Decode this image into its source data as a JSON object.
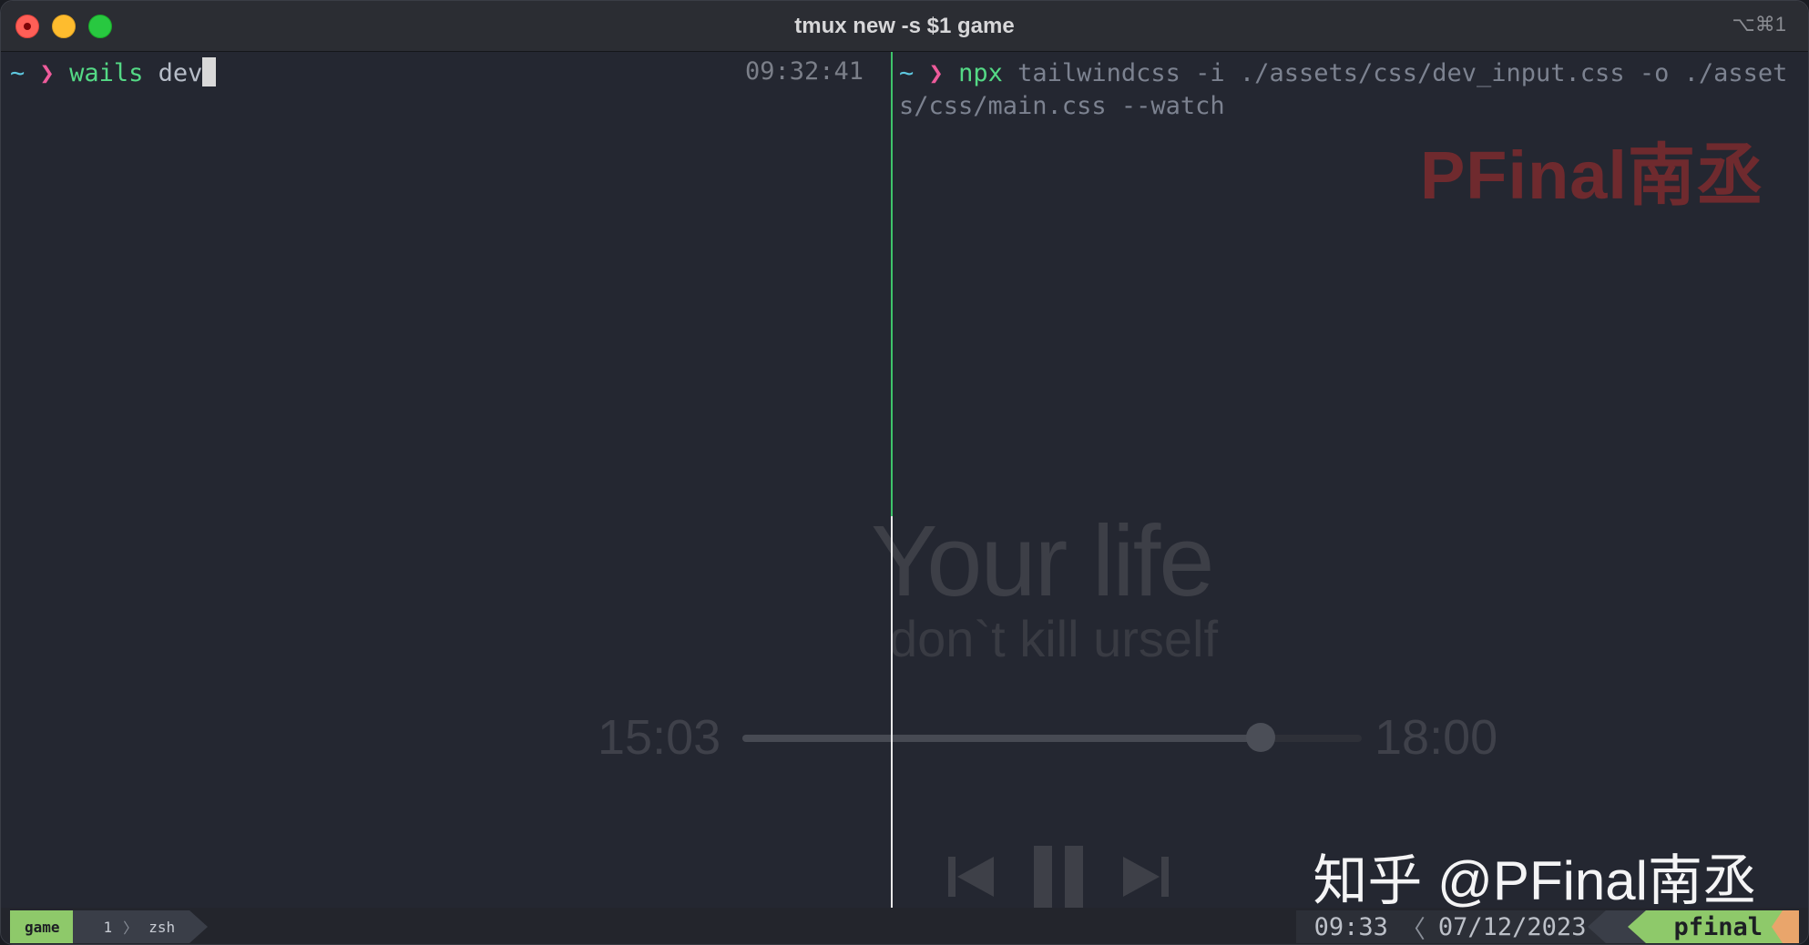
{
  "window": {
    "title": "tmux new -s $1 game",
    "shortcut": "⌥⌘1"
  },
  "left_pane": {
    "prompt_tilde": "~",
    "prompt_chevron": "❯",
    "command": "wails",
    "argument": " dev",
    "clock": "09:32:41"
  },
  "right_pane": {
    "prompt_tilde": "~",
    "prompt_chevron": "❯",
    "command": "npx",
    "args_line1": " tailwindcss -i ./assets/css/dev_input.css -o ./asset",
    "args_line2": "s/css/main.css --watch",
    "watermark": "PFinal南丞"
  },
  "background_player": {
    "title": "Your life",
    "subtitle": "don`t kill urself",
    "elapsed": "15:03",
    "total": "18:00",
    "progress": 0.8361
  },
  "watermark_zhihu": "知乎 @PFinal南丞",
  "statusbar": {
    "session": "game",
    "window_index": "1",
    "window_name": "zsh",
    "time": "09:33",
    "date": "07/12/2023",
    "host": "pfinal"
  },
  "colors": {
    "accent_green": "#8ec96a",
    "prompt_cyan": "#5ec8e0",
    "prompt_pink": "#ee5b9b",
    "command_green": "#54d985",
    "divider_green": "#3ec36a",
    "watermark_red": "#6f2a2e"
  }
}
